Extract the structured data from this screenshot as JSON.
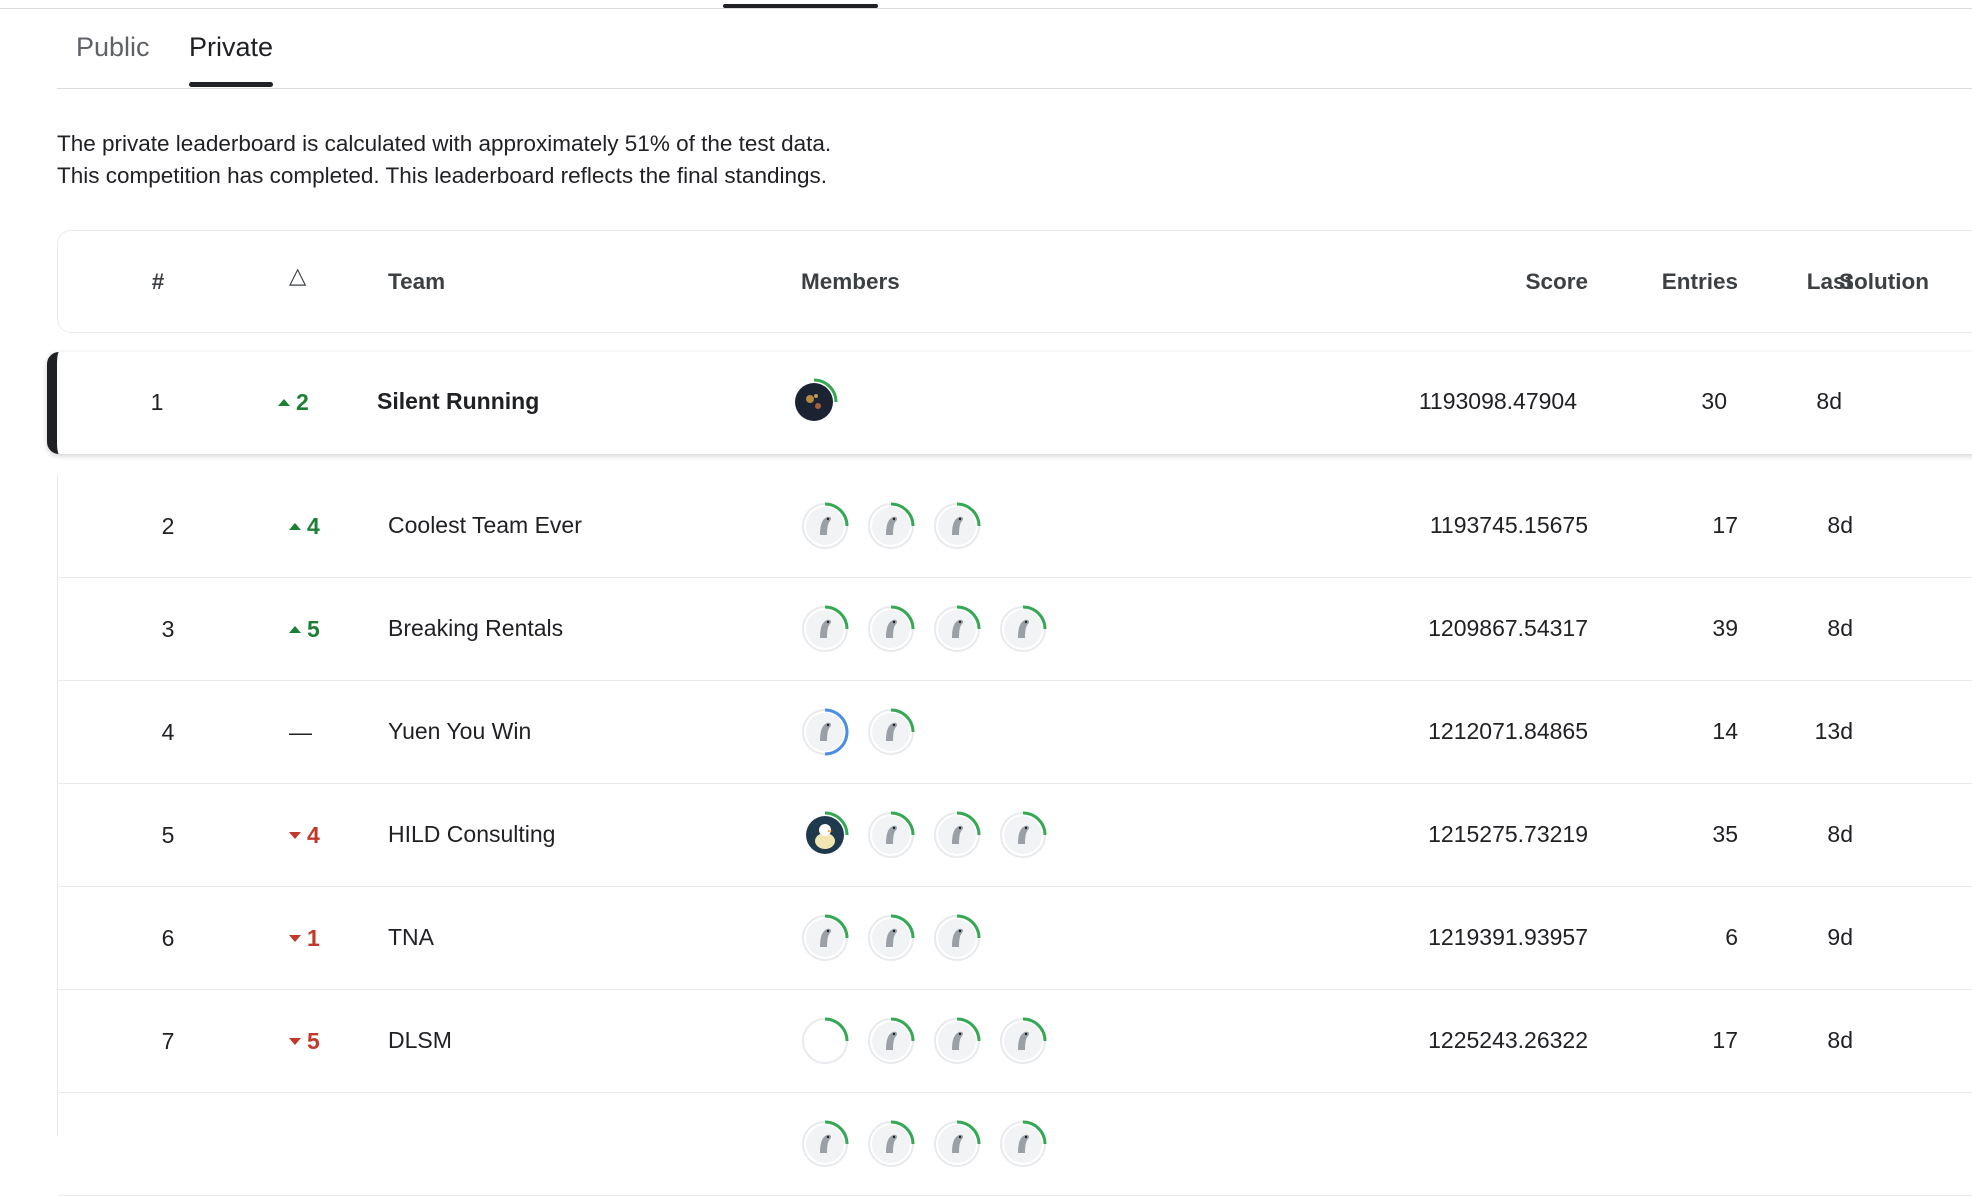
{
  "tabs": [
    {
      "label": "Public",
      "active": false
    },
    {
      "label": "Private",
      "active": true
    }
  ],
  "description": {
    "line1": "The private leaderboard is calculated with approximately 51% of the test data.",
    "line2": "This competition has completed. This leaderboard reflects the final standings."
  },
  "table": {
    "headers": {
      "rank": "#",
      "delta": "△",
      "team": "Team",
      "members": "Members",
      "score": "Score",
      "entries": "Entries",
      "last": "Last",
      "solution": "Solution"
    },
    "rows": [
      {
        "rank": "1",
        "delta": "2",
        "direction": "up",
        "team": "Silent Running",
        "members": [
          "dark-galaxy-avatar"
        ],
        "score": "1193098.47904",
        "entries": "30",
        "last": "8d"
      },
      {
        "rank": "2",
        "delta": "4",
        "direction": "up",
        "team": "Coolest Team Ever",
        "members": [
          "default-avatar",
          "default-avatar",
          "default-avatar"
        ],
        "score": "1193745.15675",
        "entries": "17",
        "last": "8d"
      },
      {
        "rank": "3",
        "delta": "5",
        "direction": "up",
        "team": "Breaking Rentals",
        "members": [
          "default-avatar",
          "default-avatar",
          "default-avatar",
          "default-avatar"
        ],
        "score": "1209867.54317",
        "entries": "39",
        "last": "8d"
      },
      {
        "rank": "4",
        "delta": "—",
        "direction": "same",
        "team": "Yuen You Win",
        "members": [
          "default-avatar-blue-ring",
          "default-avatar"
        ],
        "score": "1212071.84865",
        "entries": "14",
        "last": "13d"
      },
      {
        "rank": "5",
        "delta": "4",
        "direction": "down",
        "team": "HILD Consulting",
        "members": [
          "duck-avatar",
          "default-avatar",
          "default-avatar",
          "default-avatar"
        ],
        "score": "1215275.73219",
        "entries": "35",
        "last": "8d"
      },
      {
        "rank": "6",
        "delta": "1",
        "direction": "down",
        "team": "TNA",
        "members": [
          "default-avatar",
          "default-avatar",
          "default-avatar"
        ],
        "score": "1219391.93957",
        "entries": "6",
        "last": "9d"
      },
      {
        "rank": "7",
        "delta": "5",
        "direction": "down",
        "team": "DLSM",
        "members": [
          "blank-avatar",
          "default-avatar",
          "default-avatar",
          "default-avatar"
        ],
        "score": "1225243.26322",
        "entries": "17",
        "last": "8d"
      },
      {
        "rank": "",
        "delta": "",
        "direction": "none",
        "team": "",
        "members": [
          "default-avatar",
          "default-avatar",
          "default-avatar",
          "default-avatar"
        ],
        "score": "",
        "entries": "",
        "last": ""
      }
    ]
  },
  "colors": {
    "up": "#1e7e34",
    "down": "#c0392b",
    "ring_green": "#34a853",
    "ring_blue": "#4a90e2",
    "highlight_bar": "#202124"
  }
}
